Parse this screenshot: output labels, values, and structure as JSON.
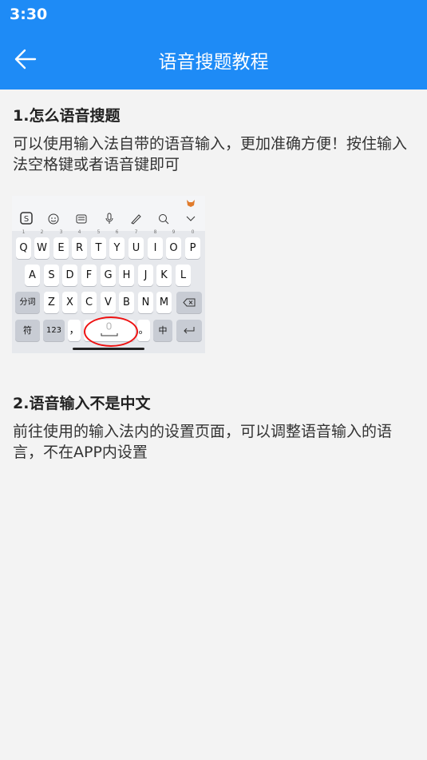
{
  "status": {
    "time": "3:30"
  },
  "header": {
    "title": "语音搜题教程",
    "back_icon": "arrow-left-icon"
  },
  "sections": [
    {
      "title": "1.怎么语音搜题",
      "text": "可以使用输入法自带的语音输入，更加准确方便！按住输入法空格键或者语音键即可"
    },
    {
      "title": "2.语音输入不是中文",
      "text": "前往使用的输入法内的设置页面，可以调整语音输入的语言，不在APP内设置"
    }
  ],
  "keyboard": {
    "row1": [
      "Q",
      "W",
      "E",
      "R",
      "T",
      "Y",
      "U",
      "I",
      "O",
      "P"
    ],
    "row2": [
      "A",
      "S",
      "D",
      "F",
      "G",
      "H",
      "J",
      "K",
      "L"
    ],
    "row3": [
      "Z",
      "X",
      "C",
      "V",
      "B",
      "N",
      "M"
    ],
    "fenci": "分词",
    "fu": "符",
    "num": "123",
    "comma": "，",
    "period": "。",
    "zh": "中"
  },
  "colors": {
    "primary": "#1e8bf6",
    "background": "#f3f3f3"
  }
}
